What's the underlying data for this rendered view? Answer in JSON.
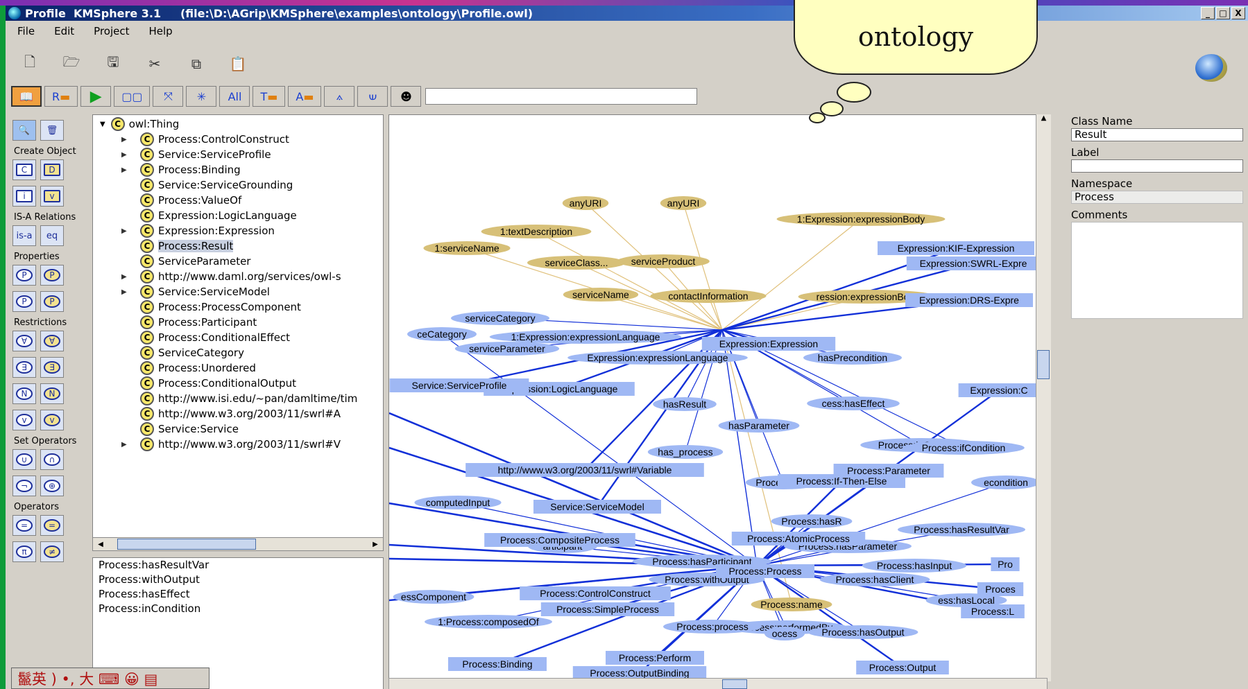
{
  "window": {
    "title": "Profile  KMSphere 3.1     (file:\\D:\\AGrip\\KMSphere\\examples\\ontology\\Profile.owl)",
    "controls": [
      "_",
      "□",
      "X"
    ]
  },
  "menu": [
    "File",
    "Edit",
    "Project",
    "Help"
  ],
  "toolbar2": [
    "R",
    "All",
    "T",
    "A"
  ],
  "callout": "ontology",
  "left_toolbar": {
    "create_object": "Create Object",
    "isa_relations": "IS-A Relations",
    "isa": "is-a",
    "eq": "eq",
    "properties": "Properties",
    "restrictions": "Restrictions",
    "set_operators": "Set Operators",
    "operators": "Operators"
  },
  "tree": {
    "root": "owl:Thing",
    "items": [
      {
        "label": "Process:ControlConstruct",
        "exp": true
      },
      {
        "label": "Service:ServiceProfile",
        "exp": true
      },
      {
        "label": "Process:Binding",
        "exp": true
      },
      {
        "label": "Service:ServiceGrounding",
        "exp": false
      },
      {
        "label": "Process:ValueOf",
        "exp": false
      },
      {
        "label": "Expression:LogicLanguage",
        "exp": false
      },
      {
        "label": "Expression:Expression",
        "exp": true
      },
      {
        "label": "Process:Result",
        "exp": false,
        "selected": true
      },
      {
        "label": "ServiceParameter",
        "exp": false
      },
      {
        "label": "http://www.daml.org/services/owl-s",
        "exp": true
      },
      {
        "label": "Service:ServiceModel",
        "exp": true
      },
      {
        "label": "Process:ProcessComponent",
        "exp": false
      },
      {
        "label": "Process:Participant",
        "exp": false
      },
      {
        "label": "Process:ConditionalEffect",
        "exp": false
      },
      {
        "label": "ServiceCategory",
        "exp": false
      },
      {
        "label": "Process:Unordered",
        "exp": false
      },
      {
        "label": "Process:ConditionalOutput",
        "exp": false
      },
      {
        "label": "http://www.isi.edu/~pan/damltime/tim",
        "exp": false
      },
      {
        "label": "http://www.w3.org/2003/11/swrl#A",
        "exp": false
      },
      {
        "label": "Service:Service",
        "exp": false
      },
      {
        "label": "http://www.w3.org/2003/11/swrl#V",
        "exp": true
      }
    ]
  },
  "properties_list": [
    "Process:hasResultVar",
    "Process:withOutput",
    "Process:hasEffect",
    "Process:inCondition"
  ],
  "graph": {
    "blue_nodes": [
      "Expression:KIF-Expression",
      "Expression:SWRL-Expre",
      "Expression:DRS-Expre",
      "Expression:Expression",
      "Expression:LogicLanguage",
      "Service:ServiceProfile",
      "http://www.w3.org/2003/11/swrl#Variable",
      "Service:ServiceModel",
      "Process:If-Then-Else",
      "Process:Parameter",
      "Process:AtomicProcess",
      "Process:CompositeProcess",
      "Process:Process",
      "Process:ControlConstruct",
      "Process:SimpleProcess",
      "Process:Perform",
      "Process:OutputBinding",
      "Process:Binding",
      "Process:Output",
      "Expression:C",
      "Pro",
      "Proces",
      "Process:L"
    ],
    "prop_nodes": [
      "serviceCategory",
      "1:Expression:expressionLanguage",
      "serviceParameter",
      "Expression:expressionLanguage",
      "hasPrecondition",
      "hasResult",
      "cess:hasEffect",
      "hasParameter",
      "has_process",
      "Process:inCondition",
      "Process:ifCondition",
      "Process:Res",
      "econdition",
      "computedInput",
      "Process:hasR",
      "Process:hasResultVar",
      "articipant",
      "Process:hasParameter",
      "Process:hasParticipant",
      "Process:withOutput",
      "Process:hasClient",
      "Process:hasInput",
      "essComponent",
      "ess:hasLocal",
      "1:Process:composedOf",
      "Process:performedBy",
      "Process:process",
      "ocess",
      "Process:hasOutput",
      "ceCategory"
    ],
    "literal_nodes": [
      "anyURI",
      "anyURI",
      "1:textDescription",
      "1:Expression:expressionBody",
      "1:serviceName",
      "serviceClass...",
      "serviceProduct",
      "serviceName",
      "contactInformation",
      "ression:expressionBody",
      "Process:name"
    ]
  },
  "class_panel": {
    "class_name_label": "Class Name",
    "class_name": "Result",
    "label_label": "Label",
    "label_value": "",
    "namespace_label": "Namespace",
    "namespace": "Process",
    "comments_label": "Comments"
  },
  "ime": "鬣英 ) •, 大 ⌨ 😀 ▤",
  "colors": {
    "blue_node": "#9fb8f4",
    "literal_node": "#d7c078",
    "edge_blue": "#1230d8",
    "edge_tan": "#e0c07a"
  }
}
